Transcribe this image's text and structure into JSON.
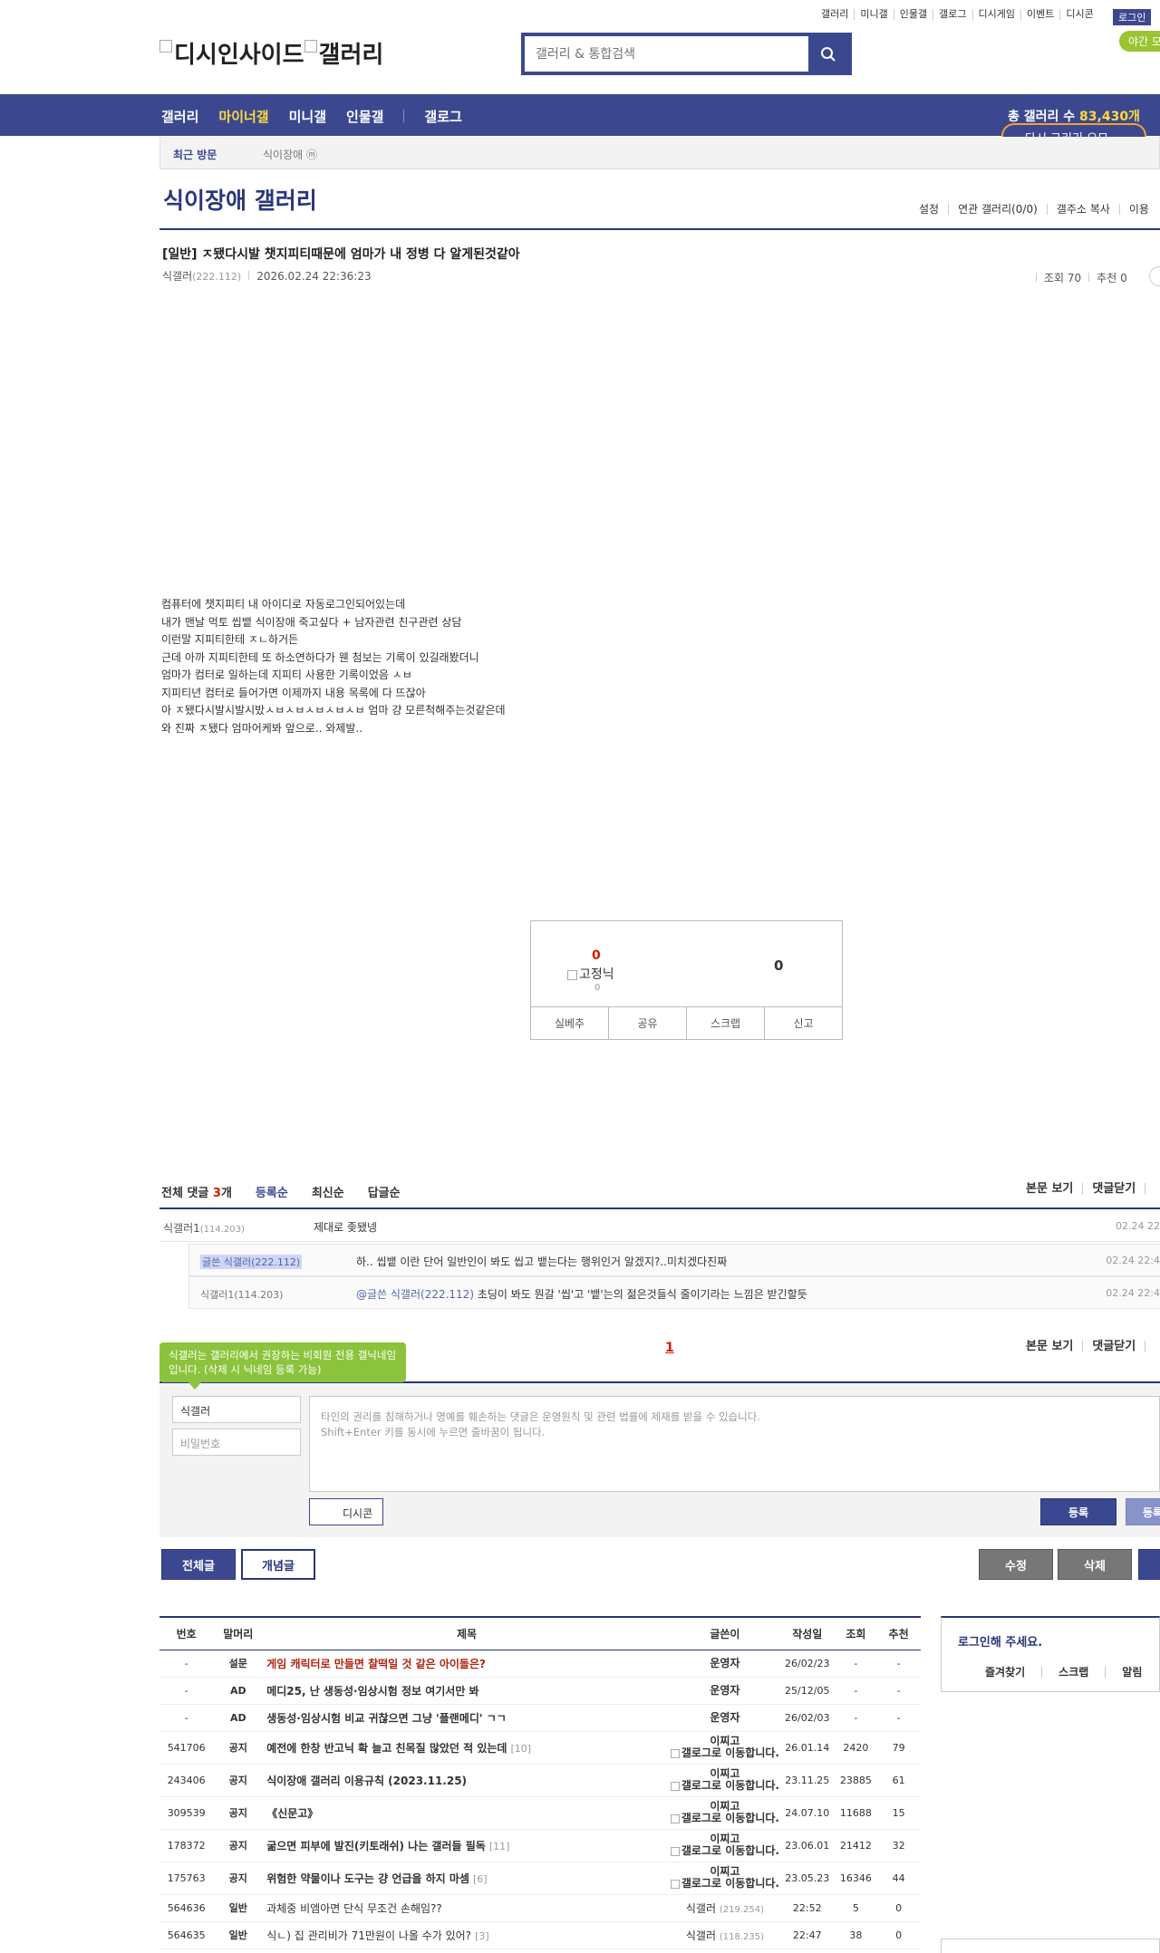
{
  "util_links": [
    "갤러리",
    "미니갤",
    "인물갤",
    "갤로그",
    "디시게임",
    "이벤트",
    "디시콘"
  ],
  "login_label": "로그인",
  "night_label": "야간 모",
  "logo_text": [
    "디시인사이드",
    "갤러리"
  ],
  "search_placeholder": "갤러리 & 통합검색",
  "nav": {
    "items": [
      "갤러리",
      "마이너갤",
      "미니갤",
      "인물갤",
      "갤로그"
    ],
    "total_prefix": "총 갤러리 수 ",
    "total_value": "83,430개",
    "pill_label": "다시 그리기 오므"
  },
  "recent": {
    "label": "최근 방문",
    "gallery": "식이장애 ⓜ"
  },
  "gallery_title": "식이장애 갤러리",
  "gallery_options": [
    "설정",
    "연관 갤러리(0/0)",
    "갤주소 복사",
    "이용"
  ],
  "post": {
    "title": "[일반] ㅈ됐다시발 챗지피티때문에 엄마가 내 정병 다 알게된것같아",
    "author": "식갤러",
    "ip": "(222.112)",
    "date": "2026.02.24 22:36:23",
    "views": "조회 70",
    "recommends": "추천 0",
    "body": "컴퓨터에 챗지피티 내 아이디로 자동로그인되어있는데\n내가 맨날 먹토 씹뱉 식이장애 죽고싶다 + 남자관련 친구관련 상담\n이런말 지피티한테 ㅈㄴ하거든\n근데 아까 지피티한테 또 하소연하다가 웬 첨보는 기록이 있길래봤더니\n엄마가 컴터로 일하는데 지피티 사용한 기록이었음 ㅅㅂ\n지피티년 컴터로 들어가면 이제까지 내용 목록에 다 뜨잖아\n아 ㅈ됐다시발시발시밨ㅅㅂㅅㅂㅅㅂㅅㅂㅅㅂ 엄마 걍 모른척해주는것같은데\n와 진짜 ㅈ됐다 엄마어케봐 앞으로.. 와제발.."
  },
  "recommend": {
    "up_count": "0",
    "up_image_alt": "고정닉",
    "up_fixed_count": "0",
    "down_count": "0",
    "buttons": [
      "실베추",
      "공유",
      "스크랩",
      "신고"
    ]
  },
  "comments_header": {
    "total_prefix": "전체 댓글 ",
    "total_count": "3",
    "total_suffix": "개",
    "sorts": [
      "등록순",
      "최신순",
      "답글순"
    ],
    "tools": [
      "본문 보기",
      "댓글닫기"
    ]
  },
  "comments": [
    {
      "name": "식갤러1",
      "ip": "(114.203)",
      "text": "제대로 좆됐넹",
      "date": "02.24 22"
    },
    {
      "name": "글쓴 식갤러",
      "ip": "(222.112)",
      "text": "하.. 씹뱉 이란 단어 일반인이 봐도 씹고 뱉는다는 행위인거 알겠지?..미치겠다진짜",
      "date": "02.24 22:4"
    },
    {
      "name": "식갤러1",
      "ip": "(114.203)",
      "mention": "@글쓴 식갤러(222.112)",
      "text": " 초딩이 봐도 뭔갈 '씹'고 '뱉'는의 젊은것들식 줄이기라는 느낌은 받긴할듯",
      "date": "02.24 22:4"
    }
  ],
  "comment_page": "1",
  "write": {
    "tooltip": "식갤러는 갤러리에서 권장하는 비회원 전용 갤닉네임입니다. (삭제 시 닉네임 등록 가능)",
    "nickname": "식갤러",
    "password_placeholder": "비밀번호",
    "textarea_placeholder": "타인의 권리를 침해하거나 명예를 훼손하는 댓글은 운영원칙 및 관련 법률에 제재를 받을 수 있습니다.\nShift+Enter 키를 동시에 누르면 줄바꿈이 됩니다.",
    "dccon_label": "디시콘",
    "submit_label": "등록",
    "submit2_label": "등록"
  },
  "post_buttons": {
    "all": "전체글",
    "concept": "개념글",
    "edit": "수정",
    "delete": "삭제"
  },
  "list_headers": [
    "번호",
    "말머리",
    "제목",
    "글쓴이",
    "작성일",
    "조회",
    "추천"
  ],
  "list_rows": [
    {
      "num": "-",
      "sub": "설문",
      "title": "게임 캐릭터로 만들면 찰떡일 것 같은 아이돌은?",
      "cc": "",
      "writer": "운영자",
      "date": "26/02/23",
      "views": "-",
      "rec": "-",
      "style": "red"
    },
    {
      "num": "-",
      "sub": "AD",
      "title": "메디25, 난 생동성·임상시험 정보 여기서만 봐",
      "cc": "",
      "writer": "운영자",
      "date": "25/12/05",
      "views": "-",
      "rec": "-",
      "style": "bold"
    },
    {
      "num": "-",
      "sub": "AD",
      "title": "생동성·임상시험 비교 귀찮으면 그냥 '플랜메디' ㄱㄱ",
      "cc": "",
      "writer": "운영자",
      "date": "26/02/03",
      "views": "-",
      "rec": "-",
      "style": "bold"
    },
    {
      "num": "541706",
      "sub": "공지",
      "title": "예전에 한창 반고닉 확 늘고 친목질 많았던 적 있는데",
      "cc": "[10]",
      "writer": "이찌고",
      "date": "26.01.14",
      "views": "2420",
      "rec": "79",
      "style": "bold",
      "img": "갤로그로 이동합니다."
    },
    {
      "num": "243406",
      "sub": "공지",
      "title": "식이장애 갤러리 이용규칙 (2023.11.25)",
      "cc": "",
      "writer": "이찌고",
      "date": "23.11.25",
      "views": "23885",
      "rec": "61",
      "style": "bold",
      "img": "갤로그로 이동합니다."
    },
    {
      "num": "309539",
      "sub": "공지",
      "title": "《신문고》",
      "cc": "",
      "writer": "이찌고",
      "date": "24.07.10",
      "views": "11688",
      "rec": "15",
      "style": "bold",
      "img": "갤로그로 이동합니다."
    },
    {
      "num": "178372",
      "sub": "공지",
      "title": "굶으면 피부에 발진(키토래쉬) 나는 갤러들 필독",
      "cc": "[11]",
      "writer": "이찌고",
      "date": "23.06.01",
      "views": "21412",
      "rec": "32",
      "style": "bold",
      "img": "갤로그로 이동합니다."
    },
    {
      "num": "175763",
      "sub": "공지",
      "title": "위험한 약물이나 도구는 걍 언급을 하지 마셈",
      "cc": "[6]",
      "writer": "이찌고",
      "date": "23.05.23",
      "views": "16346",
      "rec": "44",
      "style": "bold",
      "img": "갤로그로 이동합니다."
    },
    {
      "num": "564636",
      "sub": "일반",
      "title": "과체중 비엠아면 단식 무조건 손해임??",
      "cc": "",
      "writer": "식갤러",
      "ip": "(219.254)",
      "date": "22:52",
      "views": "5",
      "rec": "0",
      "style": "normal"
    },
    {
      "num": "564635",
      "sub": "일반",
      "title": "식ㄴ) 집 관리비가 71만원이 나올 수가 있어?",
      "cc": "[3]",
      "writer": "식갤러",
      "ip": "(118.235)",
      "date": "22:47",
      "views": "38",
      "rec": "0",
      "style": "normal"
    }
  ],
  "side": {
    "title": "로그인해 주세요.",
    "links": [
      "즐겨찾기",
      "스크랩",
      "알림"
    ]
  }
}
